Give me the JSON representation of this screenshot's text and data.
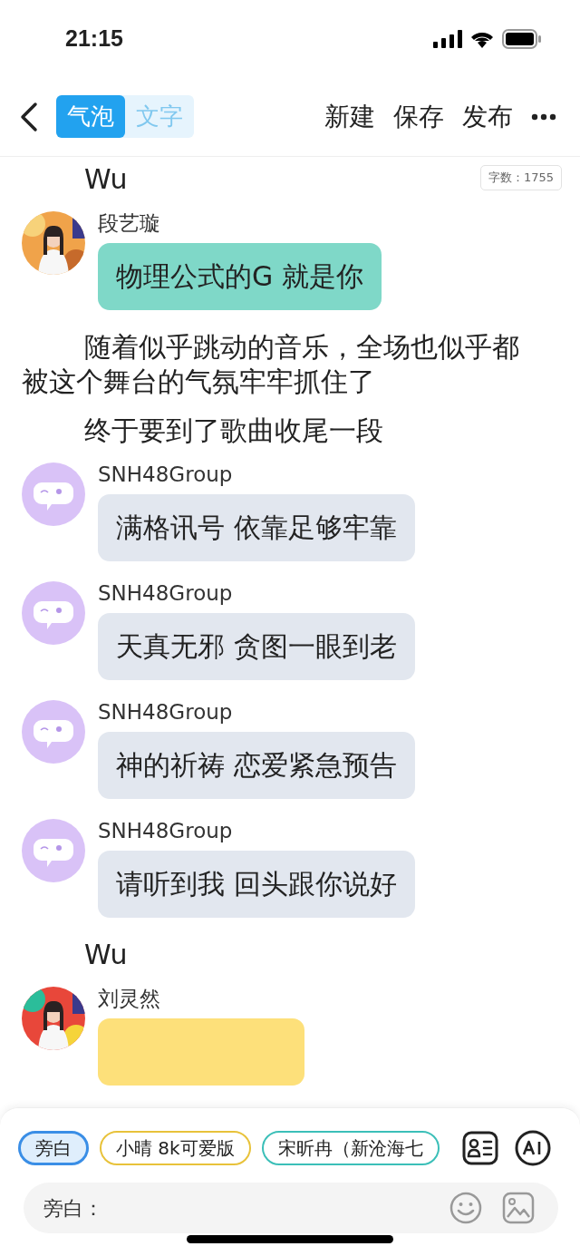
{
  "status_bar": {
    "time": "21:15"
  },
  "nav": {
    "tabs": [
      {
        "label": "气泡",
        "selected": true
      },
      {
        "label": "文字",
        "selected": false
      }
    ],
    "actions": [
      "新建",
      "保存",
      "发布"
    ]
  },
  "word_count": "字数：1755",
  "feed": [
    {
      "kind": "narration",
      "text": "Wu"
    },
    {
      "kind": "message",
      "sender": "段艺璇",
      "color": "#7fd8c8",
      "text": "物理公式的G 就是你"
    },
    {
      "kind": "narration",
      "text": "随着似乎跳动的音乐，全场也似乎都被这个舞台的气氛牢牢抓住了"
    },
    {
      "kind": "narration",
      "text": "终于要到了歌曲收尾一段"
    },
    {
      "kind": "message",
      "sender": "SNH48Group",
      "avatar": {
        "kind": "logo"
      },
      "color": "#e2e7ef",
      "text": "满格讯号 依靠足够牢靠"
    },
    {
      "kind": "message",
      "sender": "SNH48Group",
      "avatar": {
        "kind": "logo"
      },
      "color": "#e2e7ef",
      "text": "天真无邪 贪图一眼到老"
    },
    {
      "kind": "message",
      "sender": "SNH48Group",
      "avatar": {
        "kind": "logo"
      },
      "color": "#e2e7ef",
      "text": "神的祈祷 恋爱紧急预告"
    },
    {
      "kind": "message",
      "sender": "SNH48Group",
      "avatar": {
        "kind": "logo"
      },
      "color": "#e2e7ef",
      "text": "请听到我 回头跟你说好"
    },
    {
      "kind": "narration",
      "text": "Wu"
    },
    {
      "kind": "message",
      "sender": "刘灵然",
      "color": "#fde07a"
    }
  ],
  "roles": [
    {
      "label": "旁白",
      "selected": true,
      "color": "#3a8ee6"
    },
    {
      "label": "小晴 8k可爱版",
      "selected": false,
      "color": "#e8c23a"
    },
    {
      "label": "宋昕冉（新沧海七",
      "selected": false,
      "color": "#3bbfb8"
    }
  ],
  "input": {
    "placeholder": "旁白："
  }
}
